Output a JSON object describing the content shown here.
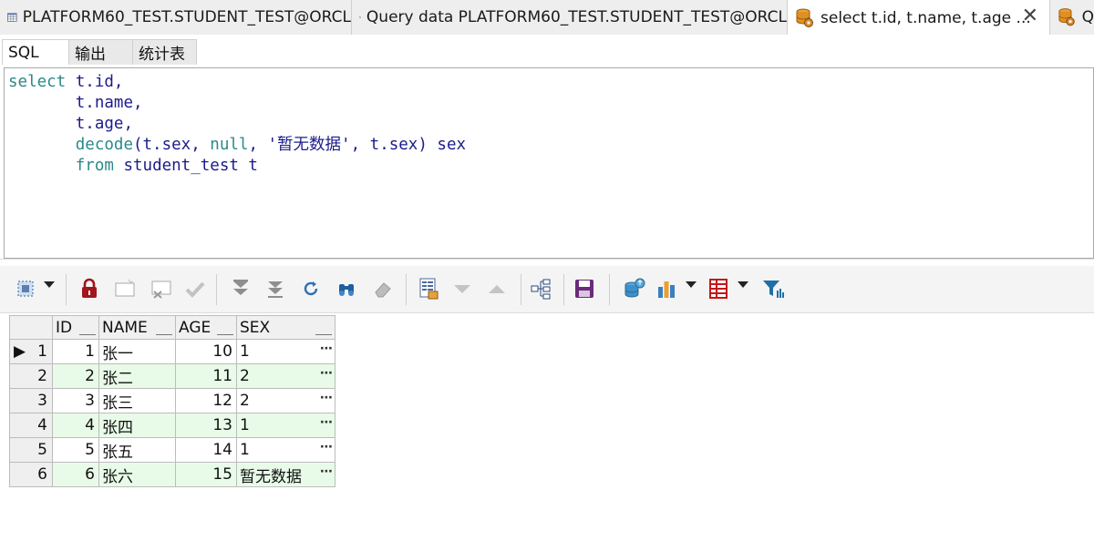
{
  "doc_tabs": [
    {
      "label": "PLATFORM60_TEST.STUDENT_TEST@ORCL",
      "icon": "table-grid-icon"
    },
    {
      "label": "Query data PLATFORM60_TEST.STUDENT_TEST@ORCL",
      "icon": "database-query-icon"
    },
    {
      "label": "select t.id, t.name, t.age ...",
      "icon": "database-query-icon",
      "active": true
    },
    {
      "label": "Q",
      "icon": "database-query-icon"
    }
  ],
  "close_glyph": "✕",
  "sub_tabs": [
    {
      "label": "SQL",
      "active": true
    },
    {
      "label": "输出"
    },
    {
      "label": "统计表"
    }
  ],
  "editor": {
    "lines": [
      {
        "kw1": "select",
        "rest": " t.id,"
      },
      {
        "indent": "       ",
        "rest": "t.name,"
      },
      {
        "indent": "       ",
        "rest": "t.age,"
      },
      {
        "indent": "       ",
        "fn": "decode",
        "a": "(t.sex, ",
        "kw2": "null",
        "b": ", ",
        "str": "'暂无数据'",
        "c": ", t.sex) sex"
      },
      {
        "indent": "       ",
        "kw1": "from",
        "rest": " student_test t"
      }
    ]
  },
  "grid": {
    "columns": [
      "ID",
      "NAME",
      "AGE",
      "SEX"
    ],
    "rows": [
      {
        "num": "1",
        "id": "1",
        "name": "张一",
        "age": "10",
        "sex": "1"
      },
      {
        "num": "2",
        "id": "2",
        "name": "张二",
        "age": "11",
        "sex": "2"
      },
      {
        "num": "3",
        "id": "3",
        "name": "张三",
        "age": "12",
        "sex": "2"
      },
      {
        "num": "4",
        "id": "4",
        "name": "张四",
        "age": "13",
        "sex": "1"
      },
      {
        "num": "5",
        "id": "5",
        "name": "张五",
        "age": "14",
        "sex": "1"
      },
      {
        "num": "6",
        "id": "6",
        "name": "张六",
        "age": "15",
        "sex": "暂无数据"
      }
    ],
    "ellipsis": "⋯",
    "current_row_marker": "▶"
  },
  "colors": {
    "alt_row": "#e8fbe8",
    "keyword": "#2a8a8a",
    "identifier": "#1c1c8c",
    "lock_red": "#a0161c",
    "save_purple": "#6b2a7a",
    "grid_red": "#c0181c",
    "filter_blue": "#1f6fa8"
  }
}
